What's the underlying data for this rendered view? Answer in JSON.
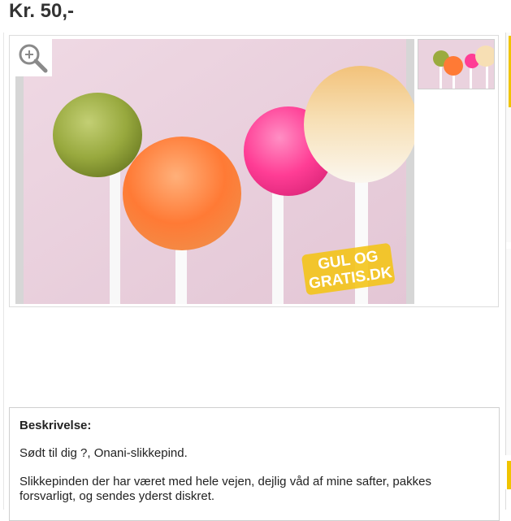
{
  "listing": {
    "price": "Kr. 50,-",
    "watermark": "GUL OG GRATIS.DK"
  },
  "gallery": {
    "zoom_icon": "magnifier-plus-icon",
    "thumbnails": 1
  },
  "description": {
    "title": "Beskrivelse:",
    "line1": "Sødt til dig ?, Onani-slikkepind.",
    "body": "Slikkepinden der har været med hele vejen, dejlig våd af mine safter, pakkes forsvarligt, og sendes yderst diskret."
  },
  "colors": {
    "accent": "#f0c400",
    "border": "#dcdcdc",
    "photo_bg": "#e9cfdc"
  }
}
